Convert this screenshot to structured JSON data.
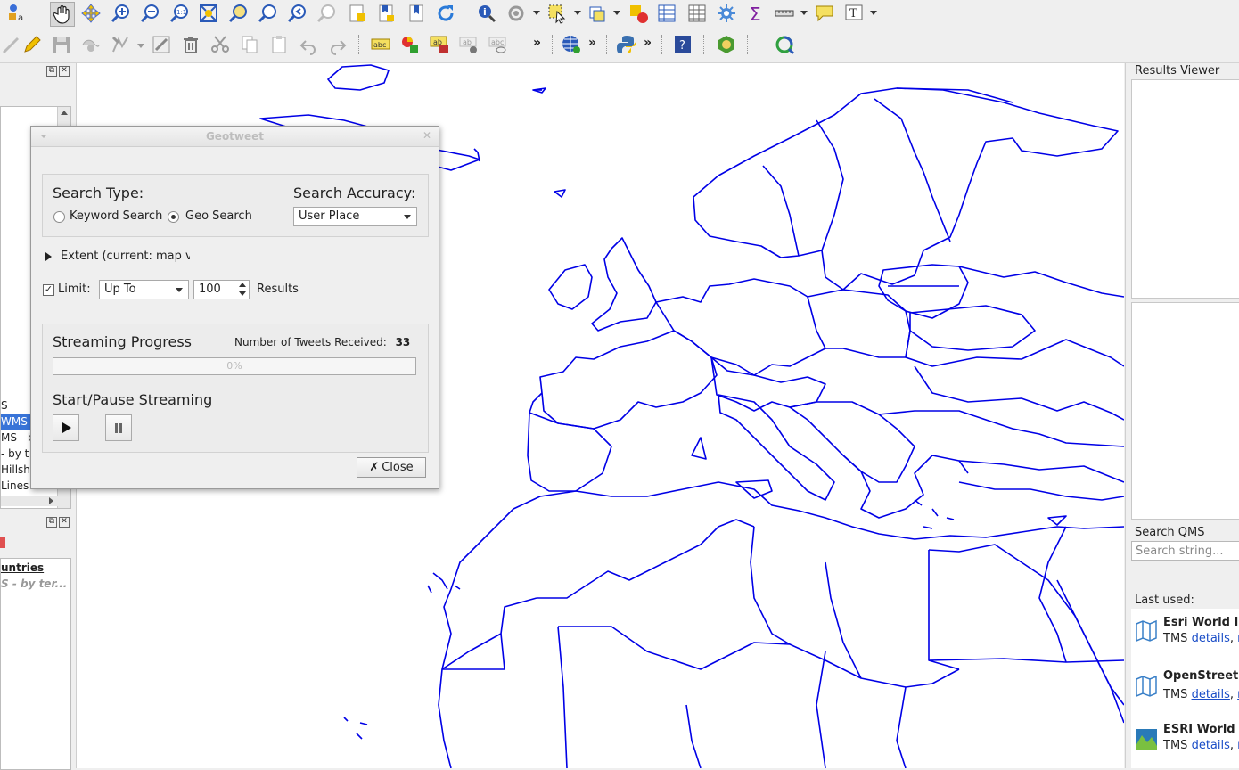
{
  "toolbar": {
    "row1": [
      "style-manager-icon",
      "pan-hand-icon",
      "pan-to-selection-icon",
      "zoom-in-icon",
      "zoom-out-icon",
      "zoom-native-icon",
      "zoom-full-icon",
      "zoom-to-selection-icon",
      "zoom-to-layer-icon",
      "zoom-last-icon",
      "zoom-next-icon",
      "new-bookmark-icon",
      "show-bookmarks-icon",
      "new-map-view-icon",
      "refresh-icon",
      "identify-icon",
      "action-icon",
      "select-features-icon",
      "deselect-icon",
      "attribute-table-icon",
      "field-calculator-icon",
      "processing-toolbox-icon",
      "statistics-sum-icon",
      "measure-icon",
      "map-tips-icon",
      "text-annotation-icon"
    ],
    "row2": [
      "digitize-icon",
      "edit-pencil-icon",
      "save-edits-icon",
      "add-feature-icon",
      "node-tool-icon",
      "modify-attributes-icon",
      "delete-selected-icon",
      "cut-features-icon",
      "copy-features-icon",
      "paste-features-icon",
      "undo-icon",
      "redo-icon",
      "label-tool-icon",
      "diagram-tool-icon",
      "pin-labels-icon",
      "show-hide-labels-icon",
      "move-label-icon",
      "overflow-chevron-icon",
      "quickmapservices-globe-icon",
      "python-console-icon",
      "help-icon",
      "plugin-green-icon",
      "geotweet-plugin-icon"
    ],
    "overflow": "»"
  },
  "left_dock": {
    "layers": [
      {
        "label": "S",
        "selected": false
      },
      {
        "label": "WMS -",
        "selected": true
      },
      {
        "label": "MS - by",
        "selected": false
      },
      {
        "label": "- by t",
        "selected": false
      },
      {
        "label": " Hillsh",
        "selected": false
      },
      {
        "label": " Lines",
        "selected": false
      }
    ],
    "browser": {
      "title": "untries",
      "subtitle": "S - by ter..."
    }
  },
  "right_dock": {
    "results_viewer": "Results Viewer",
    "search_qms": "Search QMS",
    "search_placeholder": "Search string...",
    "last_used": "Last used:",
    "services": [
      {
        "name": "Esri World Im",
        "type": "TMS",
        "details": "details",
        "extra": "re"
      },
      {
        "name": "OpenStreetM",
        "type": "TMS",
        "details": "details",
        "extra": "re"
      },
      {
        "name": "ESRI World T",
        "type": "TMS",
        "details": "details",
        "extra": "re"
      }
    ]
  },
  "dialog": {
    "title": "Geotweet",
    "search_type_label": "Search Type:",
    "keyword_search": "Keyword Search",
    "geo_search": "Geo Search",
    "search_accuracy_label": "Search Accuracy:",
    "accuracy_value": "User Place",
    "extent_label": "Extent (current: map vie",
    "limit_label": "Limit:",
    "limit_mode": "Up To",
    "limit_value": "100",
    "results_label": "Results",
    "streaming_progress": "Streaming Progress",
    "tweets_received_label": "Number of Tweets Received:",
    "tweets_received": "33",
    "progress_text": "0%",
    "progress_fraction": 0,
    "start_pause": "Start/Pause Streaming",
    "close": "Close"
  },
  "colors": {
    "map_lines": "#0000e6",
    "selection": "#3874d8",
    "link": "#1a4dc7"
  }
}
